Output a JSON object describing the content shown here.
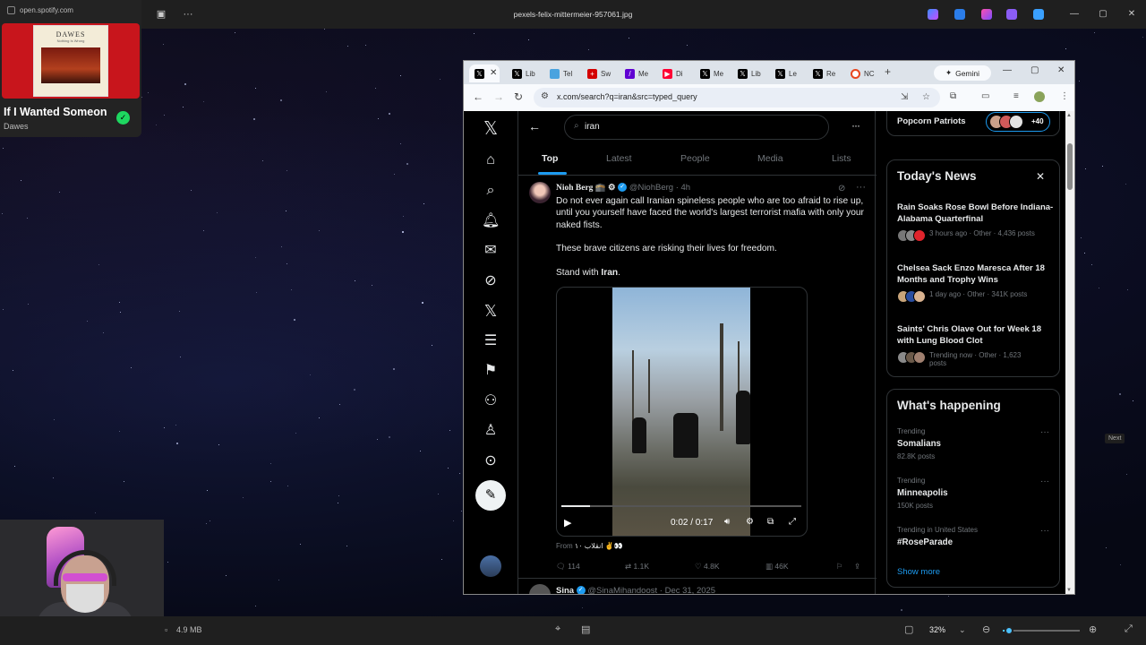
{
  "viewer": {
    "title": "pexels-felix-mittermeier-957061.jpg",
    "status": {
      "file_size": "4.9 MB",
      "zoom_percent": "32%",
      "zoom_level": 0.08
    },
    "next_hint": "Next",
    "icons": [
      "slideshow-icon",
      "more-icon",
      "minimize-icon",
      "maximize-icon",
      "close-icon",
      "fit-icon",
      "zoom-out-icon",
      "zoom-in-icon",
      "fullscreen-icon"
    ]
  },
  "spotify": {
    "url": "open.spotify.com",
    "album_title": "DAWES",
    "album_subtitle": "Nothing Is Wrong",
    "song": "If I Wanted Someone",
    "artist": "Dawes",
    "brand_color": "#1ed760",
    "card_color": "#c8151c"
  },
  "chrome": {
    "tabs": [
      {
        "label": "",
        "icon": "x-logo-icon",
        "active": true
      },
      {
        "label": "Lib",
        "icon": "x-logo-icon"
      },
      {
        "label": "Tel",
        "icon": "bird-icon"
      },
      {
        "label": "Sw",
        "icon": "swiss-icon"
      },
      {
        "label": "Me",
        "icon": "yahoo-icon"
      },
      {
        "label": "Di",
        "icon": "youtube-icon"
      },
      {
        "label": "Me",
        "icon": "x-logo-icon"
      },
      {
        "label": "Lib",
        "icon": "x-logo-icon"
      },
      {
        "label": "Le",
        "icon": "x-logo-icon"
      },
      {
        "label": "Re",
        "icon": "x-logo-icon"
      },
      {
        "label": "NC",
        "icon": "nc-icon"
      }
    ],
    "gemini_label": "Gemini",
    "url": "x.com/search?q=iran&src=typed_query"
  },
  "x": {
    "search_query": "iran",
    "tabs": [
      "Top",
      "Latest",
      "People",
      "Media",
      "Lists"
    ],
    "active_tab": "Top",
    "accent": "#1d9bf0",
    "nav_icons": [
      "x-logo-icon",
      "home-icon",
      "search-icon",
      "notifications-icon",
      "messages-icon",
      "grok-icon",
      "premium-icon",
      "lists-icon",
      "bookmarks-icon",
      "communities-icon",
      "profile-icon",
      "more-icon"
    ],
    "tweet": {
      "name": "Nioh Berg 🕋 ⚙",
      "handle": "@NiohBerg",
      "time": "4h",
      "paragraphs": [
        "Do not ever again call Iranian spineless people who are too afraid to rise up, until you yourself have faced the world's largest terrorist mafia with only your naked fists.",
        "These brave citizens are risking their lives for freedom.",
        "Stand with "
      ],
      "bold_term": "Iran",
      "trailing": ".",
      "video_time": "0:02 / 0:17",
      "video_progress": 0.12,
      "from_prefix": "From",
      "from_source": "انقلاب ۱۰ ✌️👀",
      "replies": "114",
      "reposts": "1.1K",
      "likes": "4.8K",
      "views": "46K"
    },
    "tweet2": {
      "name": "Sina",
      "handle": "@SinaMihandoost",
      "time": "Dec 31, 2025"
    },
    "community": {
      "name": "Popcorn Patriots",
      "count": "+40"
    },
    "news": {
      "title": "Today's News",
      "items": [
        {
          "title": "Rain Soaks Rose Bowl Before Indiana-Alabama Quarterfinal",
          "meta": "3 hours ago · Other · 4,436 posts"
        },
        {
          "title": "Chelsea Sack Enzo Maresca After 18 Months and Trophy Wins",
          "meta": "1 day ago · Other · 341K posts"
        },
        {
          "title": "Saints' Chris Olave Out for Week 18 with Lung Blood Clot",
          "meta": "Trending now · Other · 1,623 posts"
        }
      ]
    },
    "happening": {
      "title": "What's happening",
      "trends": [
        {
          "context": "Trending",
          "name": "Somalians",
          "posts": "82.8K posts"
        },
        {
          "context": "Trending",
          "name": "Minneapolis",
          "posts": "150K posts"
        },
        {
          "context": "Trending in United States",
          "name": "#RoseParade",
          "posts": ""
        }
      ],
      "show_more": "Show more"
    }
  }
}
